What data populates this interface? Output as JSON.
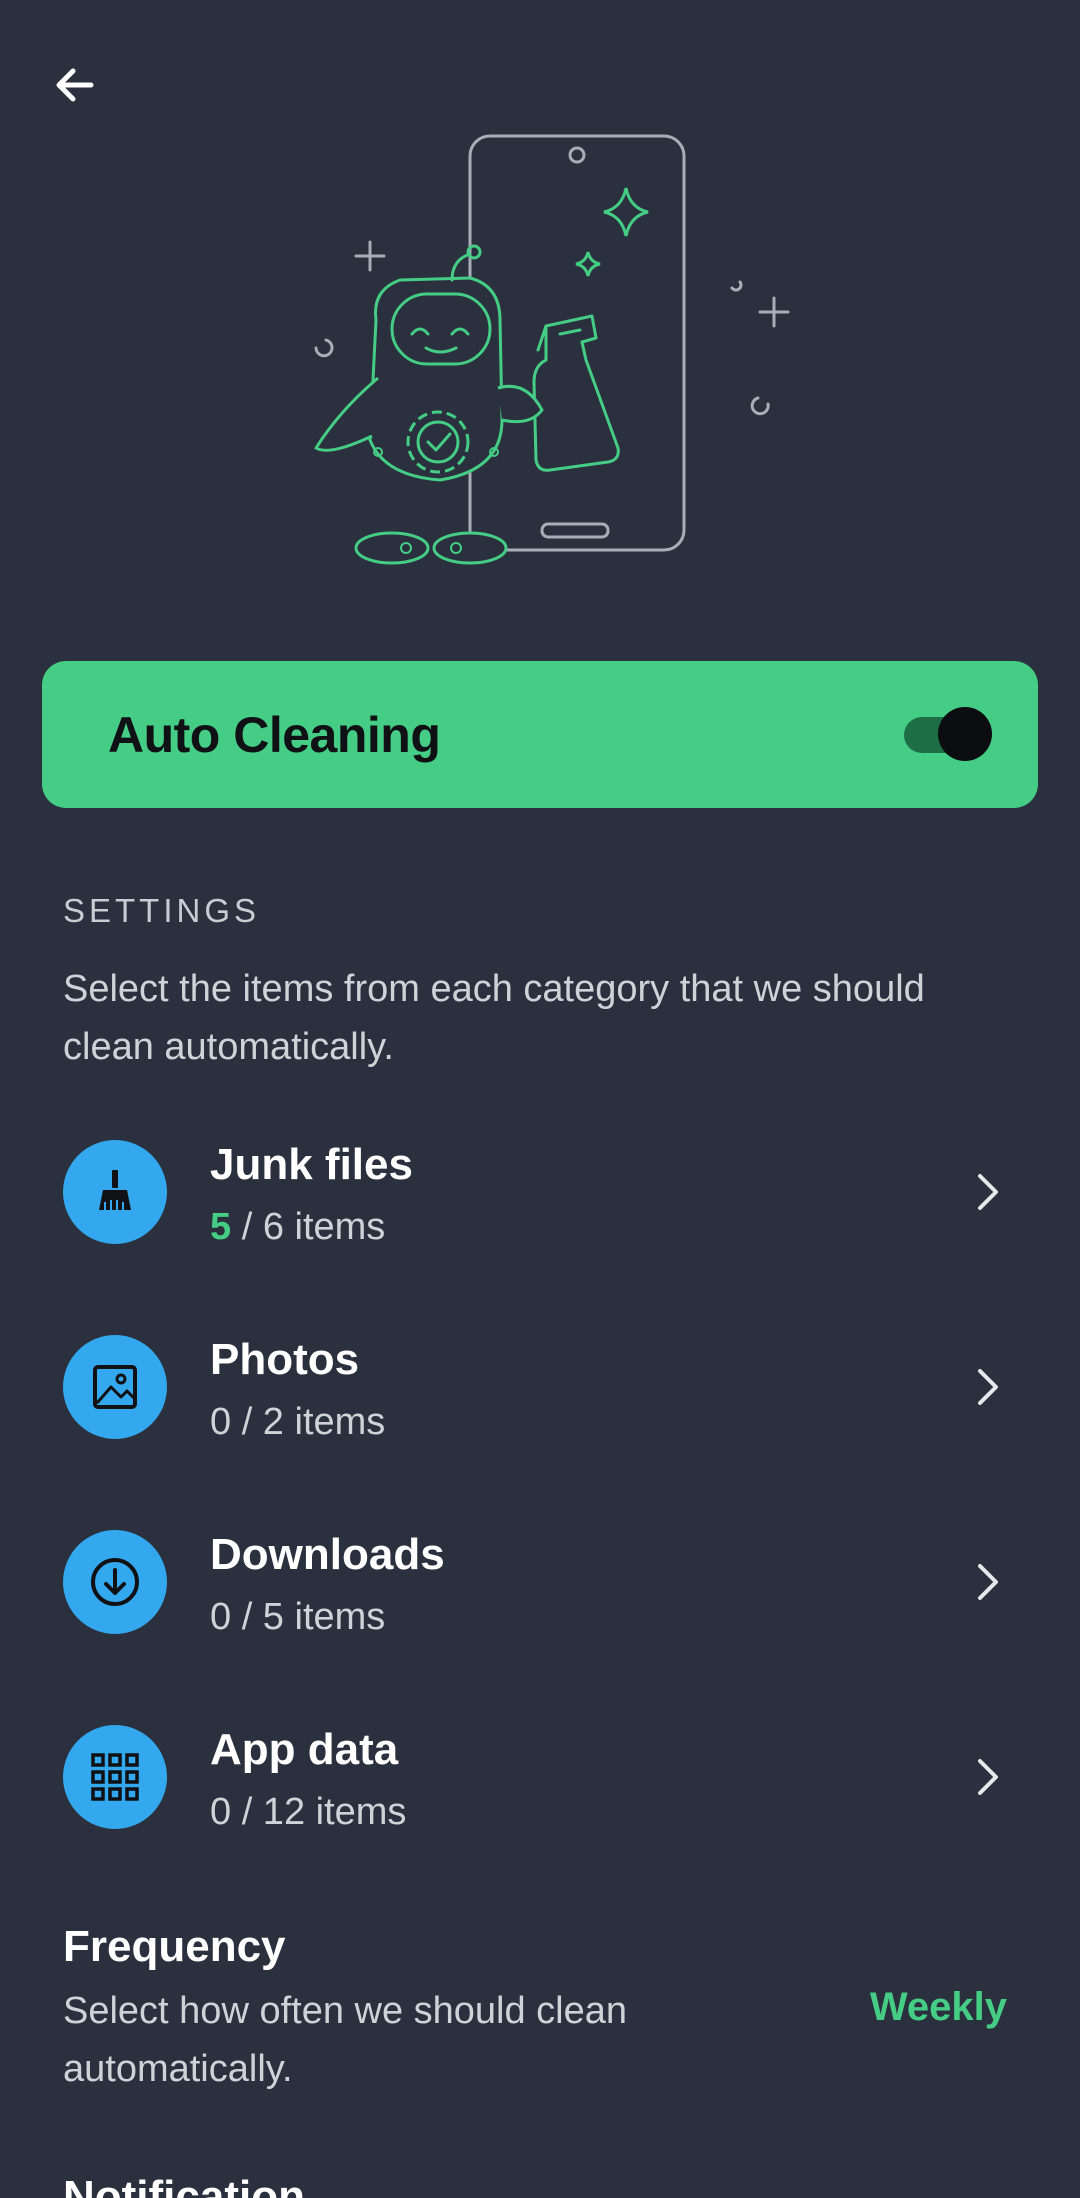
{
  "header": {
    "back_icon": "arrow-left-icon",
    "illustration": "robot-cleaning-phone-illustration"
  },
  "auto_cleaning": {
    "label": "Auto Cleaning",
    "enabled": true
  },
  "settings": {
    "section_label": "SETTINGS",
    "description": "Select the items from each category that we should clean automatically."
  },
  "categories": [
    {
      "title": "Junk files",
      "selected": "5",
      "rest": " / 6 items",
      "icon": "broom-icon"
    },
    {
      "title": "Photos",
      "selected": "",
      "rest": "0 / 2 items",
      "icon": "image-icon"
    },
    {
      "title": "Downloads",
      "selected": "",
      "rest": "0 / 5 items",
      "icon": "download-icon"
    },
    {
      "title": "App data",
      "selected": "",
      "rest": "0 / 12 items",
      "icon": "apps-grid-icon"
    }
  ],
  "frequency": {
    "title": "Frequency",
    "description": "Select how often we should clean automatically.",
    "value": "Weekly"
  },
  "notification": {
    "title": "Notification"
  },
  "colors": {
    "background": "#2a303d",
    "accent_green": "#45cc85",
    "icon_blue": "#34a8ee"
  }
}
